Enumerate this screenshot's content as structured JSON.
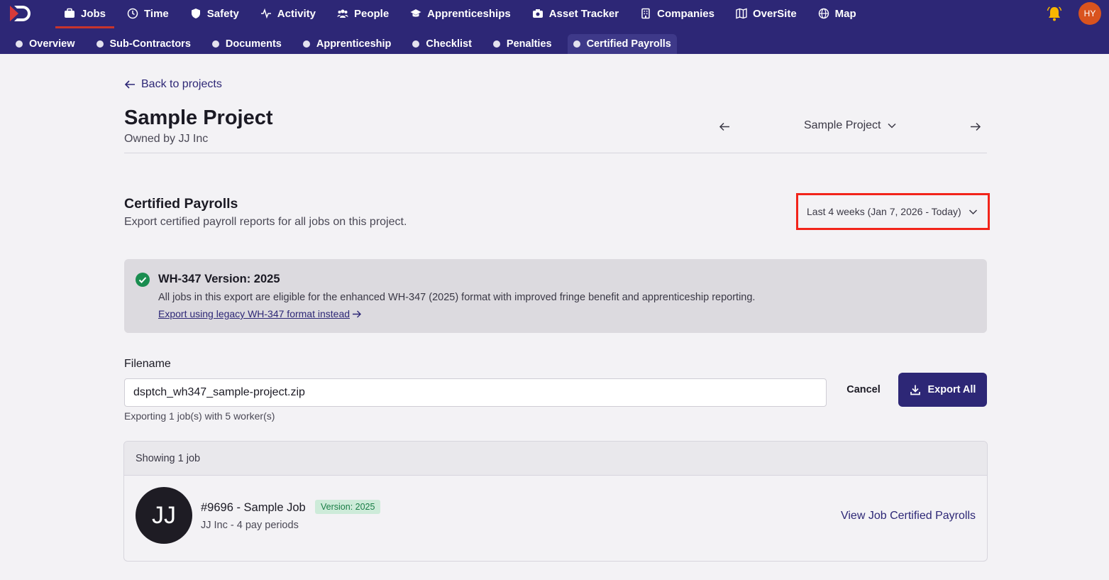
{
  "brand": {
    "accent": "#2d2776",
    "alert_box": "#f2241a",
    "avatar_bg": "#d9531e"
  },
  "nav": {
    "items": [
      {
        "label": "Jobs",
        "icon": "briefcase-icon",
        "active": true
      },
      {
        "label": "Time",
        "icon": "clock-icon"
      },
      {
        "label": "Safety",
        "icon": "shield-icon"
      },
      {
        "label": "Activity",
        "icon": "activity-icon"
      },
      {
        "label": "People",
        "icon": "people-icon"
      },
      {
        "label": "Apprenticeships",
        "icon": "graduation-cap-icon"
      },
      {
        "label": "Asset Tracker",
        "icon": "camera-icon"
      },
      {
        "label": "Companies",
        "icon": "building-icon"
      },
      {
        "label": "OverSite",
        "icon": "map-fold-icon"
      },
      {
        "label": "Map",
        "icon": "globe-icon"
      }
    ],
    "user_initials": "HY"
  },
  "subnav": {
    "items": [
      {
        "label": "Overview"
      },
      {
        "label": "Sub-Contractors"
      },
      {
        "label": "Documents"
      },
      {
        "label": "Apprenticeship"
      },
      {
        "label": "Checklist"
      },
      {
        "label": "Penalties"
      },
      {
        "label": "Certified Payrolls",
        "active": true
      }
    ]
  },
  "page": {
    "back_label": "Back to projects",
    "project_title": "Sample Project",
    "owner": "Owned by JJ Inc",
    "project_selector": "Sample Project"
  },
  "section": {
    "title": "Certified Payrolls",
    "subtitle": "Export certified payroll reports for all jobs on this project.",
    "date_range": "Last 4 weeks (Jan 7, 2026 - Today)"
  },
  "notice": {
    "title": "WH-347 Version: 2025",
    "description": "All jobs in this export are eligible for the enhanced WH-347 (2025) format with improved fringe benefit and apprenticeship reporting.",
    "link": "Export using legacy WH-347 format instead"
  },
  "export": {
    "filename_label": "Filename",
    "filename_value": "dsptch_wh347_sample-project.zip",
    "cancel_label": "Cancel",
    "export_label": "Export All",
    "hint": "Exporting 1 job(s) with 5 worker(s)"
  },
  "jobs": {
    "header": "Showing 1 job",
    "items": [
      {
        "initials": "JJ",
        "title": "#9696 - Sample Job",
        "badge": "Version: 2025",
        "subtitle": "JJ Inc - 4 pay periods",
        "link": "View Job Certified Payrolls"
      }
    ]
  }
}
